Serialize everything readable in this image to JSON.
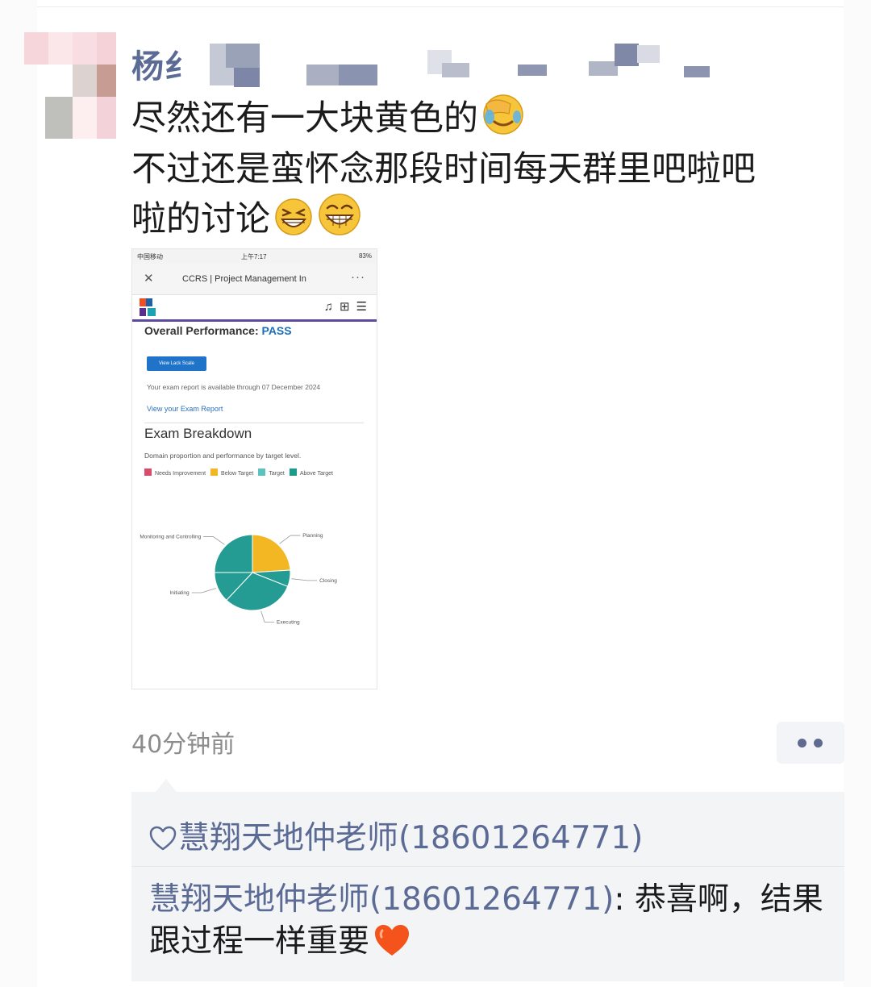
{
  "post": {
    "author_name": "杨纟",
    "text_lines": [
      "尽然还有一大块黄色的",
      "不过还是蛮怀念那段时间每天群里吧啦吧",
      "啦的讨论"
    ],
    "timestamp": "40分钟前"
  },
  "icons": {
    "facepalm": "facepalm-emoji",
    "grin": "grinning-squinting-emoji",
    "beam": "beaming-face-emoji",
    "more": "more-dots-icon",
    "like": "heart-outline-icon",
    "heart": "red-heart-emoji"
  },
  "screenshot": {
    "status_left": "中国移动",
    "status_time": "上午7:17",
    "status_right": "83%",
    "page_title": "CCRS | Project Management In",
    "overall_label": "Overall Performance:",
    "overall_value": "PASS",
    "button_label": "View Lack Scale",
    "report_note": "Your exam report is available through 07 December 2024",
    "report_link": "View your Exam Report",
    "breakdown_title": "Exam Breakdown",
    "breakdown_desc": "Domain proportion and performance by target level.",
    "legend": [
      {
        "label": "Needs Improvement",
        "color": "#d94c6b"
      },
      {
        "label": "Below Target",
        "color": "#f3b723"
      },
      {
        "label": "Target",
        "color": "#5cc2c0"
      },
      {
        "label": "Above Target",
        "color": "#1a9c8b"
      }
    ],
    "chart_data": {
      "type": "pie",
      "slices": [
        {
          "label": "Planning",
          "value": 24,
          "level": "Below Target",
          "color": "#f3b723"
        },
        {
          "label": "Closing",
          "value": 7,
          "level": "Above Target",
          "color": "#249c93"
        },
        {
          "label": "Executing",
          "value": 31,
          "level": "Above Target",
          "color": "#249c93"
        },
        {
          "label": "Initiating",
          "value": 13,
          "level": "Above Target",
          "color": "#249c93"
        },
        {
          "label": "Monitoring and Controlling",
          "value": 25,
          "level": "Above Target",
          "color": "#249c93"
        }
      ]
    }
  },
  "interactions": {
    "likes": "慧翔天地仲老师(18601264771)",
    "comment_author": "慧翔天地仲老师(18601264771)",
    "comment_text": ": 恭喜啊，结果跟过程一样重要"
  },
  "colors": {
    "name_blue": "#5b6b95",
    "timestamp_gray": "#8c8c8c",
    "panel_bg": "#f3f4f6",
    "pie_yellow": "#f3b723",
    "pie_teal": "#249c93"
  }
}
